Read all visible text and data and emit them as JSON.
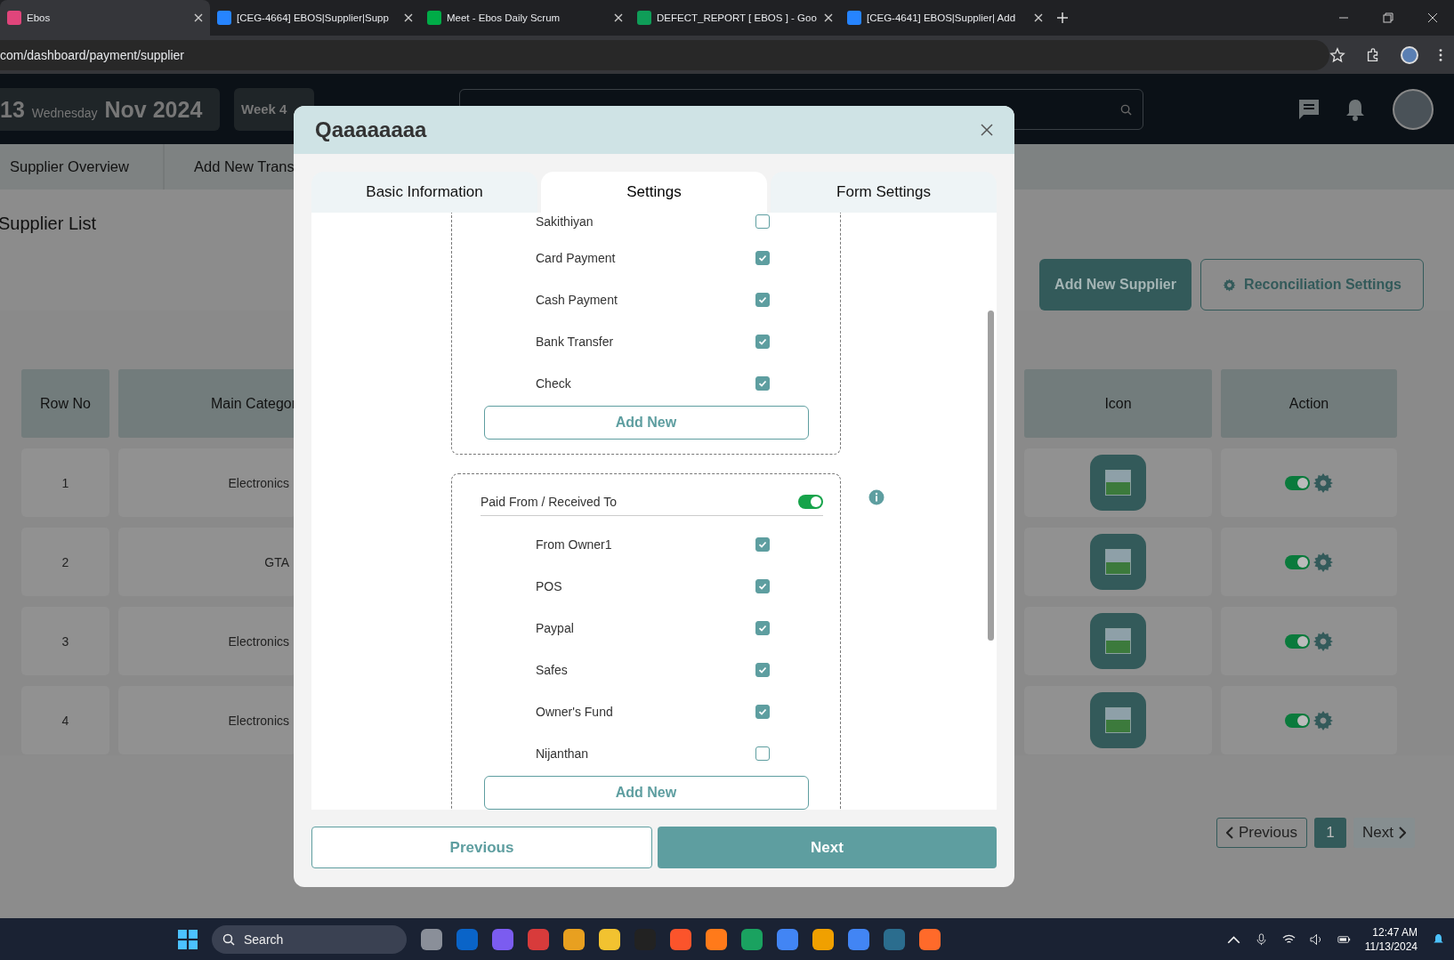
{
  "browser": {
    "tabs": [
      {
        "title": "Ebos",
        "selected": true,
        "color": "#e0457b"
      },
      {
        "title": "[CEG-4664] EBOS|Supplier|Supp",
        "selected": false,
        "color": "#2684ff"
      },
      {
        "title": "Meet - Ebos Daily Scrum",
        "selected": false,
        "color": "#00ac47"
      },
      {
        "title": "DEFECT_REPORT [ EBOS ] - Goo",
        "selected": false,
        "color": "#0f9d58"
      },
      {
        "title": "[CEG-4641] EBOS|Supplier| Add",
        "selected": false,
        "color": "#2684ff"
      }
    ],
    "url": "com/dashboard/payment/supplier"
  },
  "header": {
    "day": "13",
    "weekday": "Wednesday",
    "month_year": "Nov 2024",
    "week": "Week 4"
  },
  "nav": {
    "tabs": [
      "Supplier Overview",
      "Add New Trans"
    ]
  },
  "page": {
    "title": "Supplier List",
    "add_button": "Add New Supplier",
    "settings_button": "Reconciliation Settings",
    "columns": [
      "Row No",
      "Main Categor",
      "Icon",
      "Action"
    ],
    "rows": [
      {
        "row_no": "1",
        "main_category": "Electronics",
        "enabled": true
      },
      {
        "row_no": "2",
        "main_category": "GTA",
        "enabled": true
      },
      {
        "row_no": "3",
        "main_category": "Electronics",
        "enabled": true
      },
      {
        "row_no": "4",
        "main_category": "Electronics",
        "enabled": true
      }
    ],
    "pagination": {
      "previous": "Previous",
      "pages": [
        {
          "label": "1",
          "selected": true
        }
      ],
      "next": "Next"
    }
  },
  "modal": {
    "title": "Qaaaaaaaa",
    "tabs": [
      {
        "label": "Basic Information",
        "selected": false
      },
      {
        "label": "Settings",
        "selected": true
      },
      {
        "label": "Form Settings",
        "selected": false
      }
    ],
    "groups": [
      {
        "items": [
          {
            "label": "Sakithiyan",
            "checked": false
          },
          {
            "label": "Card Payment",
            "checked": true
          },
          {
            "label": "Cash Payment",
            "checked": true
          },
          {
            "label": "Bank Transfer",
            "checked": true
          },
          {
            "label": "Check",
            "checked": true
          }
        ],
        "add_label": "Add New"
      },
      {
        "title": "Paid From / Received To",
        "on": true,
        "items": [
          {
            "label": "From Owner1",
            "checked": true
          },
          {
            "label": "POS",
            "checked": true
          },
          {
            "label": "Paypal",
            "checked": true
          },
          {
            "label": "Safes",
            "checked": true
          },
          {
            "label": "Owner's Fund",
            "checked": true
          },
          {
            "label": "Nijanthan",
            "checked": false
          }
        ],
        "add_label": "Add New"
      }
    ],
    "previous": "Previous",
    "next": "Next"
  },
  "taskbar": {
    "search": "Search",
    "time": "12:47 AM",
    "date": "11/13/2024"
  }
}
